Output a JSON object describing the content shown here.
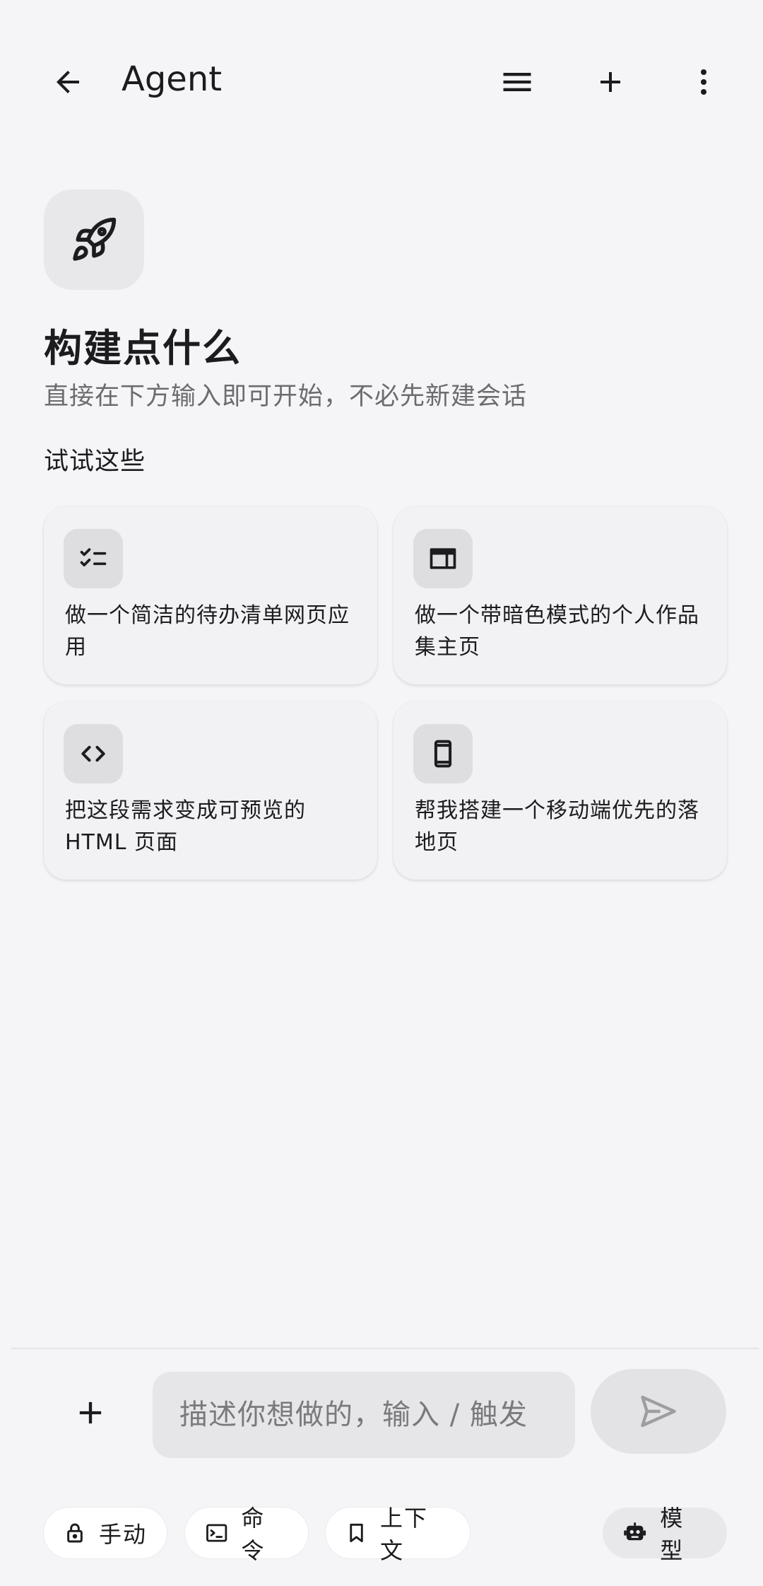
{
  "header": {
    "title": "Agent"
  },
  "hero": {
    "title": "构建点什么",
    "subtitle": "直接在下方输入即可开始，不必先新建会话",
    "section_label": "试试这些"
  },
  "suggestions": [
    {
      "text": "做一个简洁的待办清单网页应用",
      "icon": "checklist-icon"
    },
    {
      "text": "做一个带暗色模式的个人作品集主页",
      "icon": "web-layout-icon"
    },
    {
      "text": "把这段需求变成可预览的 HTML 页面",
      "icon": "code-icon"
    },
    {
      "text": "帮我搭建一个移动端优先的落地页",
      "icon": "smartphone-icon"
    }
  ],
  "composer": {
    "placeholder": "描述你想做的，输入 / 触发",
    "value": ""
  },
  "chips": {
    "manual": "手动",
    "command": "命令",
    "context": "上下文",
    "model": "模型"
  }
}
